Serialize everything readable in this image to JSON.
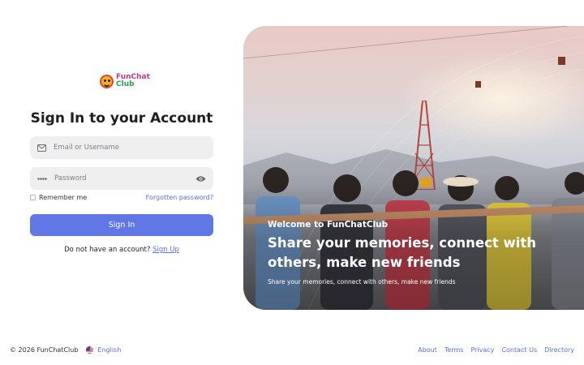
{
  "brand": {
    "line1": "FunChat",
    "line2": "Club"
  },
  "form": {
    "title": "Sign In to your Account",
    "email_placeholder": "Email or Username",
    "password_placeholder": "Password",
    "remember_label": "Remember me",
    "forgot_label": "Forgotten password?",
    "signin_label": "Sign In",
    "no_account_text": "Do not have an account?",
    "signup_label": "Sign Up"
  },
  "hero": {
    "eyebrow": "Welcome to FunChatClub",
    "headline": "Share your memories, connect with others, make new friends",
    "subtext": "Share your memories, connect with others, make new friends"
  },
  "footer": {
    "copyright": "© 2026 FunChatClub",
    "language": "English",
    "links": [
      "About",
      "Terms",
      "Privacy",
      "Contact Us",
      "Directory"
    ]
  },
  "colors": {
    "accent": "#6177e6",
    "link": "#5a6ee0",
    "field_bg": "#efefef"
  }
}
